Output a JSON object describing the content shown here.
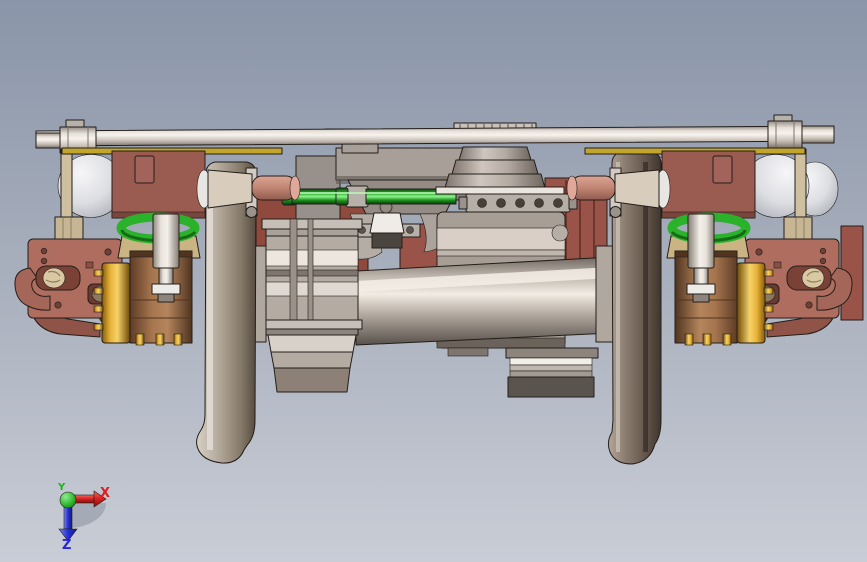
{
  "app": {
    "name": "cad-viewport",
    "view_description": "front view of railway bogie wheelset assembly with traction motor"
  },
  "background": {
    "top": "#8a95a9",
    "middle": "#a9b0bd",
    "bottom": "#c9cdd6"
  },
  "triad": {
    "x": {
      "label": "X",
      "color": "#dd1f1f"
    },
    "y": {
      "label": "Y",
      "color": "#20b020"
    },
    "z": {
      "label": "Z",
      "color": "#2525e0"
    }
  },
  "model": {
    "name": "railway-bogie-wheelset-with-traction-motor",
    "parts": [
      {
        "name": "lateral-support-pipe",
        "color": "#d8d2ca"
      },
      {
        "name": "left-wheel",
        "color": "#b3a99d"
      },
      {
        "name": "right-wheel",
        "color": "#8a7c6f"
      },
      {
        "name": "axle",
        "color": "#cfc7bd"
      },
      {
        "name": "traction-motor",
        "color": "#a79e96"
      },
      {
        "name": "motor-mount-bracket-5-holes",
        "color": "#b6afa7"
      },
      {
        "name": "coupling-drum",
        "color": "#b4aba3"
      },
      {
        "name": "cone-suspension-stack",
        "color": "#a89f97"
      },
      {
        "name": "disc-cap-riser",
        "color": "#c4bdb5"
      },
      {
        "name": "air-spring-left",
        "color": "#e9eaec"
      },
      {
        "name": "air-spring-right",
        "color": "#e9eaec"
      },
      {
        "name": "axlebox-housing-left",
        "color": "#9a5b51"
      },
      {
        "name": "axlebox-housing-right",
        "color": "#9a5b51"
      },
      {
        "name": "brake-cylinder-brown",
        "color": "#9a6b48"
      },
      {
        "name": "brake-cylinder-gold-flange",
        "color": "#d7a21f"
      },
      {
        "name": "green-spring-ring",
        "color": "#2ab22a"
      },
      {
        "name": "green-shaft",
        "color": "#35c435"
      },
      {
        "name": "frame-bracket-left",
        "color": "#ae6d5e"
      },
      {
        "name": "frame-bracket-right",
        "color": "#ae6d5e"
      },
      {
        "name": "piston-rod",
        "color": "#c9c2ba"
      },
      {
        "name": "salmon-duct",
        "color": "#c98f7e"
      },
      {
        "name": "gold-strip",
        "color": "#c2a62c"
      }
    ]
  }
}
